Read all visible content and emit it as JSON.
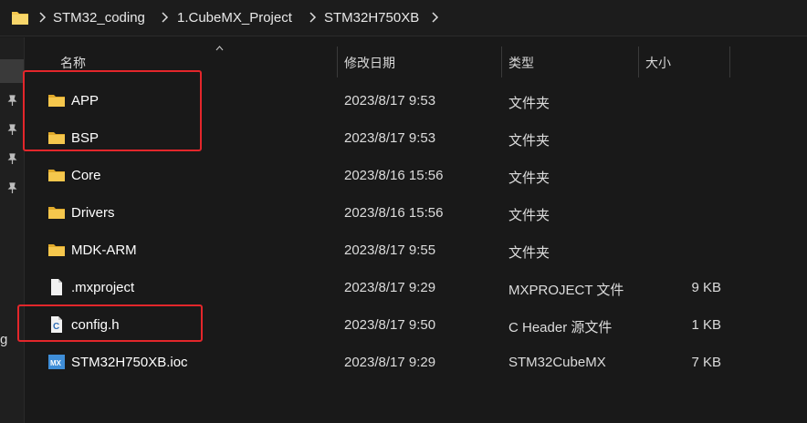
{
  "address_bar": {
    "breadcrumbs": [
      "STM32_coding",
      "1.CubeMX_Project",
      "STM32H750XB"
    ]
  },
  "nav": {
    "partial_label": "g"
  },
  "columns": {
    "name": "名称",
    "modified": "修改日期",
    "type": "类型",
    "size": "大小"
  },
  "files": [
    {
      "name": "APP",
      "modified": "2023/8/17 9:53",
      "type": "文件夹",
      "size": "",
      "icon": "folder-icon"
    },
    {
      "name": "BSP",
      "modified": "2023/8/17 9:53",
      "type": "文件夹",
      "size": "",
      "icon": "folder-icon"
    },
    {
      "name": "Core",
      "modified": "2023/8/16 15:56",
      "type": "文件夹",
      "size": "",
      "icon": "folder-icon"
    },
    {
      "name": "Drivers",
      "modified": "2023/8/16 15:56",
      "type": "文件夹",
      "size": "",
      "icon": "folder-icon"
    },
    {
      "name": "MDK-ARM",
      "modified": "2023/8/17 9:55",
      "type": "文件夹",
      "size": "",
      "icon": "folder-icon"
    },
    {
      "name": ".mxproject",
      "modified": "2023/8/17 9:29",
      "type": "MXPROJECT 文件",
      "size": "9 KB",
      "icon": "file-icon"
    },
    {
      "name": "config.h",
      "modified": "2023/8/17 9:50",
      "type": "C Header 源文件",
      "size": "1 KB",
      "icon": "c-header-file-icon"
    },
    {
      "name": "STM32H750XB.ioc",
      "modified": "2023/8/17 9:29",
      "type": "STM32CubeMX",
      "size": "7 KB",
      "icon": "stm32cubemx-file-icon"
    }
  ],
  "colors": {
    "background": "#191919",
    "highlight": "#e3262b",
    "folder": "#f5c74d"
  }
}
